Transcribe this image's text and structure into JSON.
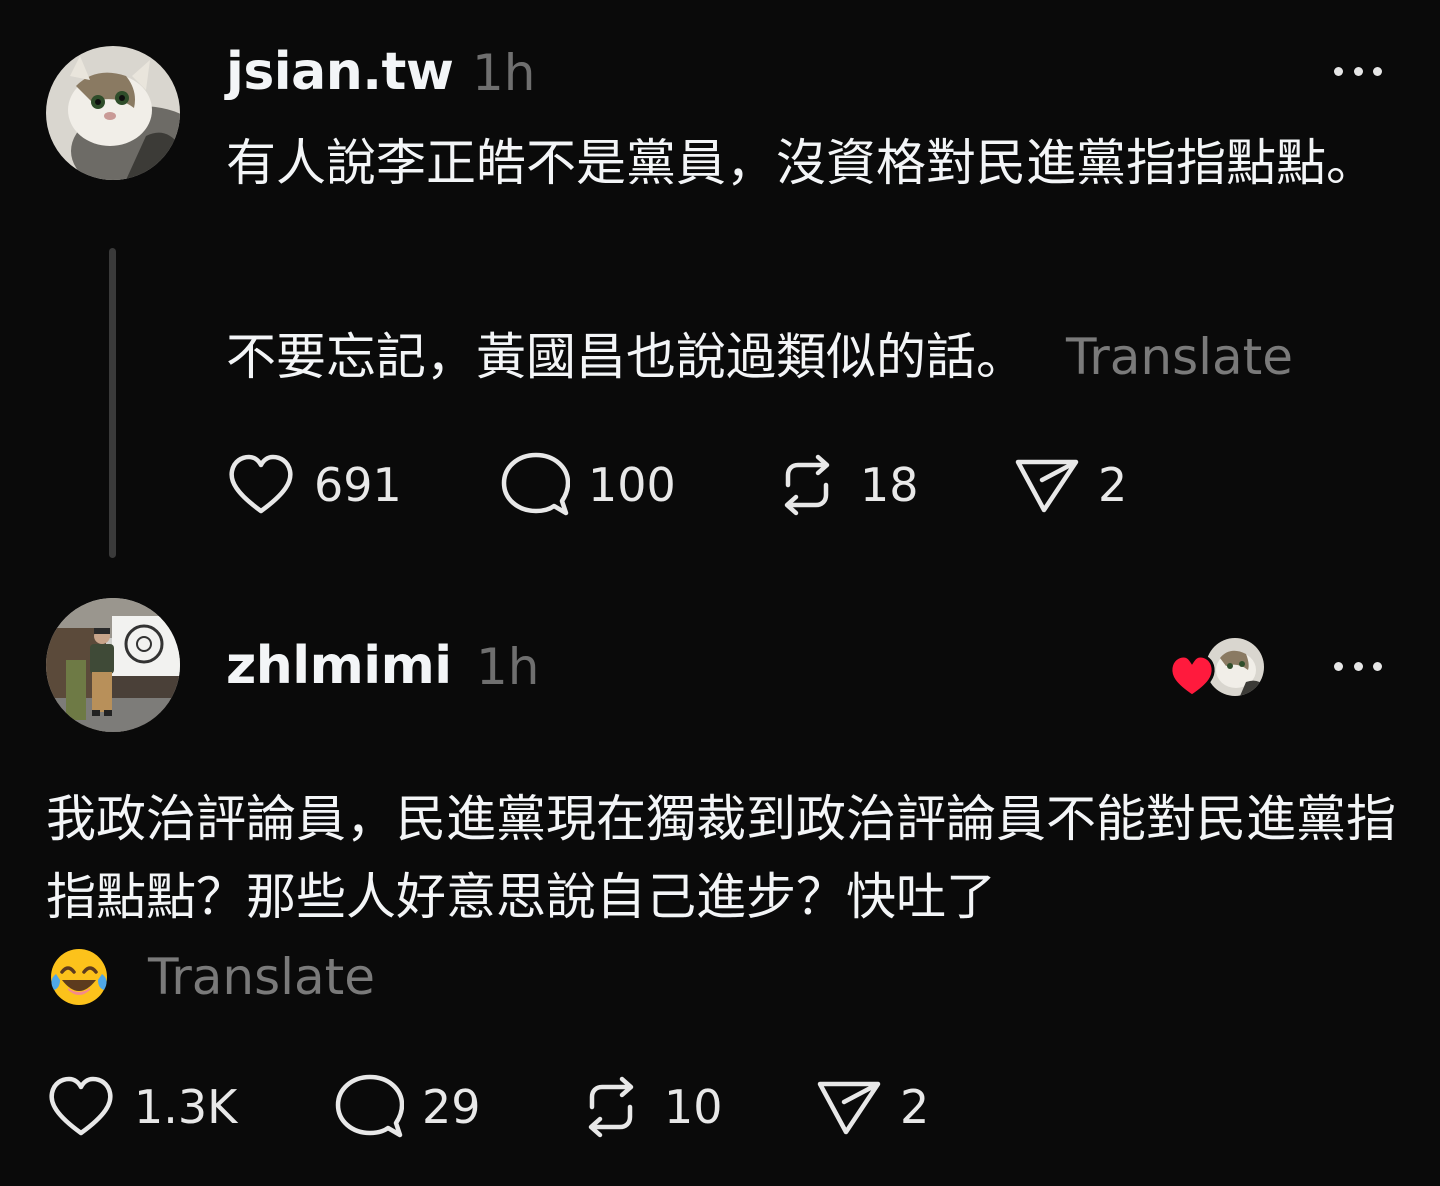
{
  "posts": [
    {
      "username": "jsian.tw",
      "time": "1h",
      "text_lines": [
        "有人說李正皓不是黨員，沒資格對民進黨指指點點。",
        "不要忘記，黃國昌也說過類似的話。"
      ],
      "translate": "Translate",
      "likes": "691",
      "replies": "100",
      "reposts": "18",
      "shares": "2"
    },
    {
      "username": "zhlmimi",
      "time": "1h",
      "text": "我政治評論員，民進黨現在獨裁到政治評論員不能對民進黨指指點點？那些人好意思說自己進步？快吐了",
      "translate": "Translate",
      "likes": "1.3K",
      "replies": "29",
      "reposts": "10",
      "shares": "2"
    }
  ],
  "icons": {
    "more": "more-horizontal-icon",
    "like": "heart-icon",
    "reply": "comment-bubble-icon",
    "repost": "repost-icon",
    "share": "send-icon",
    "emoji": "laughing-tears-emoji-icon",
    "liked_by": "liked-by-author-icon"
  },
  "colors": {
    "background": "#0a0a0a",
    "text": "#f3f5f7",
    "muted": "#7a7a7a",
    "heart": "#ff1a3d"
  }
}
